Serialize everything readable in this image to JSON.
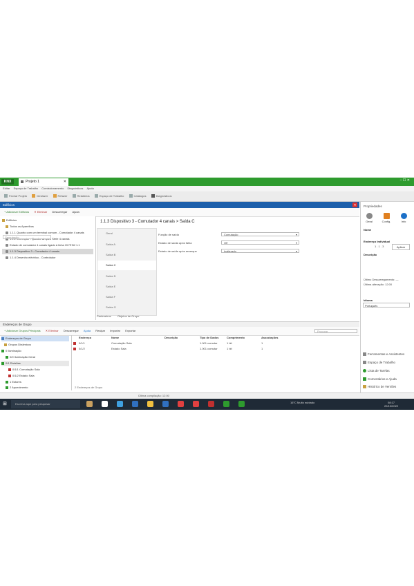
{
  "app": {
    "logo": "KNX",
    "tab_label": "Projeto 1",
    "tab_close": "✕",
    "window_controls": "–   ☐   ✕"
  },
  "menu": [
    "Editar",
    "Espaço de Trabalho",
    "Comissionamento",
    "Diagnósticos",
    "Ajuda"
  ],
  "toolbar": [
    "Fechar Projeto",
    "Desfazer",
    "Refazer",
    "Relatórios",
    "Espaço de Trabalho",
    "Catálogos",
    "Diagnósticos"
  ],
  "top_pane": {
    "title": "Edifícios",
    "close": "✕",
    "toolbar": [
      "+ Adicionar Edifícios",
      "✕ Eliminar",
      "Descarregar",
      "Ajuda"
    ],
    "tree": [
      {
        "label": "Edifícios",
        "type": "folder"
      },
      {
        "label": "Todos os Aparelhos",
        "type": "folder"
      },
      {
        "label": "1.1.1 Quadro com um terminal comum - Comutador 4 canais",
        "type": "device"
      },
      {
        "label": "1.1.2 Interruptor - Quadro simples Série 4 canais",
        "type": "device"
      },
      {
        "label": "Estado de comutador 4 canais ligado à linha OCTHW 1.1",
        "type": "device"
      },
      {
        "label": "1.1.3 Dispositivo 3 - Comutador 4 canais",
        "type": "device"
      },
      {
        "label": "1.1.4 Desenho eléctrico - Controlador",
        "type": "device"
      }
    ],
    "detail_title": "1.1.3 Dispositivo 3 - Comutador 4 canais > Saída C",
    "side_tabs": [
      "Geral",
      "Saída A",
      "Saída B",
      "Saída C",
      "Saída D",
      "Saída E",
      "Saída F",
      "Saída G"
    ],
    "params": [
      {
        "label": "Função de saída",
        "value": "Comutação"
      },
      {
        "label": "Estado de saída após falha",
        "value": "Off"
      },
      {
        "label": "Estado de saída após arranque",
        "value": "Inalterado"
      }
    ],
    "bottom_tabs": [
      "Parâmetros",
      "Objetos de Grupo"
    ]
  },
  "bottom_pane": {
    "title": "Endereços de Grupo",
    "toolbar": [
      "+ Adicionar Grupos Principais",
      "✕ Eliminar",
      "Descarregar",
      "Ajuda",
      "Realçar",
      "Importar",
      "Exportar"
    ],
    "search_placeholder": "Procurar",
    "tree": [
      {
        "label": "Endereços de Grupo",
        "color": "#4a7fc0",
        "indent": 0,
        "selected": true
      },
      {
        "label": "Grupos Dinâmicos",
        "color": "#c8a040",
        "indent": 0
      },
      {
        "label": "0 Iluminação",
        "color": "#2e9b2e",
        "indent": 0
      },
      {
        "label": "0/0 Iluminação Geral",
        "color": "#2e9b2e",
        "indent": 1
      },
      {
        "label": "0/1 Divisões",
        "color": "#2e9b2e",
        "indent": 0
      },
      {
        "label": "0/1/1 Comutação Sala",
        "color": "#c03030",
        "indent": 2
      },
      {
        "label": "0/1/2 Estado Sala",
        "color": "#c03030",
        "indent": 2
      },
      {
        "label": "1 Estores",
        "color": "#2e9b2e",
        "indent": 1
      },
      {
        "label": "2 Aquecimento",
        "color": "#2e9b2e",
        "indent": 1
      }
    ],
    "columns": [
      "Endereço",
      "Nome",
      "Descrição",
      "Tipo de Dados",
      "Comprimento",
      "Associações"
    ],
    "rows": [
      [
        "0/1/1",
        "Comutação Sala",
        "",
        "1.001 comutar",
        "1 bit",
        "1"
      ],
      [
        "0/1/2",
        "Estado Sala",
        "",
        "1.001 comutar",
        "1 bit",
        "1"
      ]
    ],
    "status": "2 Endereços de Grupo"
  },
  "right_panel": {
    "title": "Propriedades",
    "buttons": [
      {
        "label": "Geral",
        "color": "#888888"
      },
      {
        "label": "Config.",
        "color": "#e08020"
      },
      {
        "label": "Info",
        "color": "#1c70c8"
      }
    ],
    "name_label": "Nome",
    "name_placeholder": "Comutação",
    "addr_label": "Endereço Individual",
    "addr_value": "1 . 1 . 3",
    "apply": "Aplicar",
    "desc_label": "Descrição",
    "info_1": "Último Descarregamento: —",
    "info_2": "Última alteração: 12:00",
    "lang_label": "Idioma",
    "lang_value": "Português",
    "links": [
      {
        "label": "Ferramentas e Assistentes",
        "color": "#888888"
      },
      {
        "label": "Espaço de Trabalho",
        "color": "#888888"
      },
      {
        "label": "Lista de Tarefas",
        "color": "#2e9b2e"
      },
      {
        "label": "Comentários e Ajuda",
        "color": "#2e9b2e"
      },
      {
        "label": "Histórico de Versões",
        "color": "#c8a040"
      }
    ]
  },
  "statusbar": "Última compilação: 12:00",
  "taskbar": {
    "search": "Escreva aqui para pesquisar",
    "icons": [
      "#c8a060",
      "#ffffff",
      "#3fa0e0",
      "#3070c0",
      "#f0c040",
      "#3070c0",
      "#e04040",
      "#e04040",
      "#c03030",
      "#2e9b2e",
      "#2e9b2e"
    ],
    "tray": "16°C  Muito nublado",
    "time": "08:17",
    "date": "22/10/2022"
  }
}
